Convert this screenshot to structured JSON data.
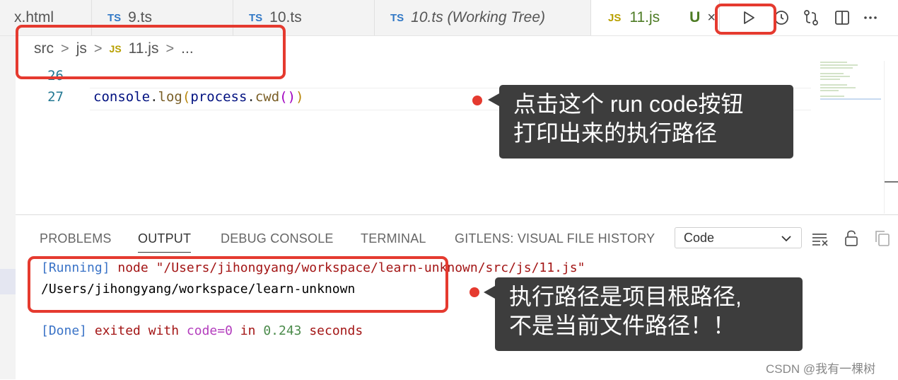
{
  "tabs": [
    {
      "badge": "",
      "label": "x.html",
      "italic": false
    },
    {
      "badge": "TS",
      "label": "9.ts",
      "italic": false
    },
    {
      "badge": "TS",
      "label": "10.ts",
      "italic": false
    },
    {
      "badge": "TS",
      "label": "10.ts (Working Tree)",
      "italic": true
    },
    {
      "badge": "JS",
      "label": "11.js",
      "status": "U",
      "close": "×",
      "active": true
    }
  ],
  "toolbar_icons": [
    "run-code-icon",
    "history-icon",
    "compare-changes-icon",
    "split-editor-icon",
    "more-actions-icon"
  ],
  "breadcrumb": {
    "parts": [
      "src",
      "js",
      "11.js",
      "..."
    ],
    "js_badge": "JS",
    "separator": ">"
  },
  "editor": {
    "lines": [
      {
        "number": "26",
        "code": ""
      },
      {
        "number": "27",
        "code": "console.log(process.cwd())"
      }
    ],
    "code_tokens": [
      "console",
      ".",
      "log",
      "(",
      "process",
      ".",
      "cwd",
      "(",
      ")",
      ")"
    ]
  },
  "panel": {
    "tabs": [
      "PROBLEMS",
      "OUTPUT",
      "DEBUG CONSOLE",
      "TERMINAL",
      "GITLENS: VISUAL FILE HISTORY"
    ],
    "active_tab": "OUTPUT",
    "channel_select": "Code",
    "output": {
      "running_tag": "[Running]",
      "running_cmd": " node \"/Users/jihongyang/workspace/learn-unknown/src/js/11.js\"",
      "cwd": "/Users/jihongyang/workspace/learn-unknown",
      "done_tag": "[Done]",
      "done_a": " exited with ",
      "done_code": "code=0",
      "done_b": " in ",
      "done_time": "0.243",
      "done_c": " seconds"
    }
  },
  "annotations": {
    "callout_run": [
      "点击这个 run code按钮",
      "打印出来的执行路径"
    ],
    "callout_path": [
      "执行路径是项目根路径,",
      "不是当前文件路径！！"
    ],
    "watermark": "CSDN @我有一棵树",
    "accent": "#e53a2f"
  },
  "colors": {
    "tab_bg": "#f3f3f3",
    "active_tab_text": "#4d7b24",
    "ts_badge": "#3178c6",
    "js_badge": "#b8a000",
    "line_number": "#237893",
    "token_object": "#001080",
    "token_function": "#795e26",
    "output_blue": "#3a73c7",
    "output_red": "#a31515",
    "output_green": "#4a8a4a",
    "output_purple": "#b33dbd"
  }
}
